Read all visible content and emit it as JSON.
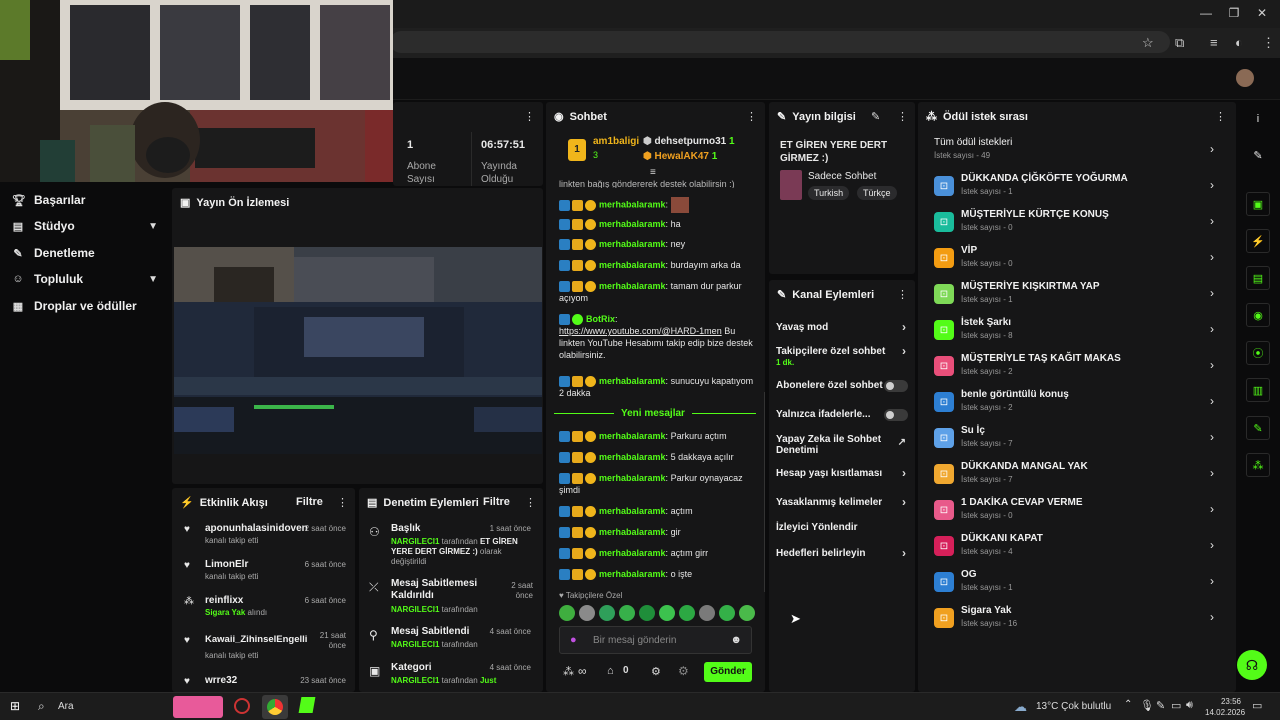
{
  "window": {
    "minimize": "—",
    "maximize": "❐",
    "close": "✕"
  },
  "sidebar": {
    "items": [
      {
        "label": "Başarılar"
      },
      {
        "label": "Stüdyo"
      },
      {
        "label": "Denetleme"
      },
      {
        "label": "Topluluk"
      },
      {
        "label": "Droplar ve ödüller"
      }
    ]
  },
  "stats": {
    "abone_value": "1",
    "abone_label": "Abone Sayısı",
    "uptime_value": "06:57:51",
    "uptime_label": "Yayında Olduğu"
  },
  "preview": {
    "title": "Yayın Ön İzlemesi"
  },
  "events": {
    "title": "Etkinlik Akışı",
    "filter": "Filtre",
    "items": [
      {
        "name": "aponunhalasinidoven",
        "sub": "kanalı takip etti",
        "time": "2 saat önce"
      },
      {
        "name": "LimonElr",
        "sub": "kanalı takip etti",
        "time": "6 saat önce"
      },
      {
        "name": "reinflixx",
        "sub_green": "Sigara Yak",
        "sub": " alındı",
        "time": "6 saat önce"
      },
      {
        "name": "Kawaii_ZihinselEngelli",
        "sub": "kanalı takip etti",
        "time": "21 saat önce"
      },
      {
        "name": "wrre32",
        "sub": "",
        "time": "23 saat önce"
      }
    ]
  },
  "mod": {
    "title": "Denetim Eylemleri",
    "filter": "Filtre",
    "items": [
      {
        "title": "Başlık",
        "time": "1 saat önce",
        "by": "NARGILECI1",
        "by_text": " tarafından ",
        "bold": "ET GİREN YERE DERT GİRMEZ :)",
        "tail": " olarak değiştirildi"
      },
      {
        "title": "Mesaj Sabitlemesi Kaldırıldı",
        "time": "2 saat önce",
        "by": "NARGILECI1",
        "by_text": " tarafından",
        "bold": "",
        "tail": ""
      },
      {
        "title": "Mesaj Sabitlendi",
        "time": "4 saat önce",
        "by": "NARGILECI1",
        "by_text": " tarafından",
        "bold": "",
        "tail": ""
      },
      {
        "title": "Kategori",
        "time": "4 saat önce",
        "by": "NARGILECI1",
        "by_text": " tarafından ",
        "bold": "",
        "tail": "Just"
      }
    ]
  },
  "chat": {
    "title": "Sohbet",
    "top": [
      {
        "name": "am1baligi",
        "count": "3"
      },
      {
        "name": "dehsetpurno31",
        "count": "1"
      },
      {
        "name": "HewalAK47",
        "count": "1"
      }
    ],
    "cut_text": "linkten bağış göndererek destek olabilirsin :)",
    "messages": [
      {
        "user": "merhabalaramk",
        "text": ""
      },
      {
        "user": "merhabalaramk",
        "text": "ha"
      },
      {
        "user": "merhabalaramk",
        "text": "ney"
      },
      {
        "user": "merhabalaramk",
        "text": "burdayım arka da"
      },
      {
        "user": "merhabalaramk",
        "text": "tamam dur parkur açıyom"
      }
    ],
    "bot": {
      "user": "BotRix",
      "link": "https://www.youtube.com/@HARD-1men",
      "text": " Bu linkten YouTube Hesabımı takip edip bize destek olabilirsiniz."
    },
    "after_bot": {
      "user": "merhabalaramk",
      "text": "sunucuyu kapatıyom 2 dakka"
    },
    "new_messages": "Yeni mesajlar",
    "new": [
      {
        "user": "merhabalaramk",
        "text": "Parkuru açtım"
      },
      {
        "user": "merhabalaramk",
        "text": "5 dakkaya açılır"
      },
      {
        "user": "merhabalaramk",
        "text": "Parkur oynayacaz şimdi"
      },
      {
        "user": "merhabalaramk",
        "text": "açtım"
      },
      {
        "user": "merhabalaramk",
        "text": "gir"
      },
      {
        "user": "merhabalaramk",
        "text": "açtım girr"
      },
      {
        "user": "merhabalaramk",
        "text": "o işte"
      }
    ],
    "followers_only": "Takipçilere Özel",
    "input_placeholder": "Bir mesaj gönderin",
    "infinite": "∞",
    "count": "0",
    "send": "Gönder"
  },
  "stream_info": {
    "title": "Yayın bilgisi",
    "stream_title": "ET GİREN YERE DERT GİRMEZ :)",
    "category": "Sadece Sohbet",
    "tags": [
      "Turkish",
      "Türkçe"
    ]
  },
  "channel_actions": {
    "title": "Kanal Eylemleri",
    "items": [
      {
        "label": "Yavaş mod",
        "sub": ""
      },
      {
        "label": "Takipçilere özel sohbet",
        "sub": "1 dk."
      },
      {
        "label": "Abonelere özel sohbet",
        "sub": ""
      },
      {
        "label": "Yalnızca ifadelerle...",
        "sub": ""
      },
      {
        "label": "Yapay Zeka ile Sohbet Denetimi",
        "sub": ""
      },
      {
        "label": "Hesap yaşı kısıtlaması",
        "sub": ""
      },
      {
        "label": "Yasaklanmış kelimeler",
        "sub": ""
      },
      {
        "label": "İzleyici Yönlendir",
        "sub": ""
      },
      {
        "label": "Hedefleri belirleyin",
        "sub": ""
      }
    ]
  },
  "rewards": {
    "title": "Ödül istek sırası",
    "all": {
      "label": "Tüm ödül istekleri",
      "count": "İstek sayısı - 49"
    },
    "items": [
      {
        "label": "DÜKKANDA ÇİĞKÖFTE YOĞURMA",
        "count": "İstek sayısı - 1",
        "color": "#4a90d9"
      },
      {
        "label": "MÜŞTERİYLE KÜRTÇE KONUŞ",
        "count": "İstek sayısı - 0",
        "color": "#1abc9c"
      },
      {
        "label": "VİP",
        "count": "İstek sayısı - 0",
        "color": "#f39c12"
      },
      {
        "label": "MÜŞTERİYE KIŞKIRTMA YAP",
        "count": "İstek sayısı - 1",
        "color": "#7ed957"
      },
      {
        "label": "İstek Şarkı",
        "count": "İstek sayısı - 8",
        "color": "#53fc18"
      },
      {
        "label": "MÜŞTERİYLE TAŞ KAĞIT MAKAS",
        "count": "İstek sayısı - 2",
        "color": "#e94f7a"
      },
      {
        "label": "benle görüntülü konuş",
        "count": "İstek sayısı - 2",
        "color": "#2d7fd3"
      },
      {
        "label": "Su İç",
        "count": "İstek sayısı - 7",
        "color": "#5ea1e8"
      },
      {
        "label": "DÜKKANDA MANGAL YAK",
        "count": "İstek sayısı - 7",
        "color": "#f0a830"
      },
      {
        "label": "1 DAKİKA CEVAP VERME",
        "count": "İstek sayısı - 0",
        "color": "#e85a8a"
      },
      {
        "label": "DÜKKANI KAPAT",
        "count": "İstek sayısı - 4",
        "color": "#d6205a"
      },
      {
        "label": "OG",
        "count": "İstek sayısı - 1",
        "color": "#2d7fd3"
      },
      {
        "label": "Sigara Yak",
        "count": "İstek sayısı - 16",
        "color": "#f0a020"
      }
    ]
  },
  "taskbar": {
    "search": "Ara",
    "weather": "13°C  Çok bulutlu",
    "time": "23:56",
    "date": "14.02.2026"
  }
}
